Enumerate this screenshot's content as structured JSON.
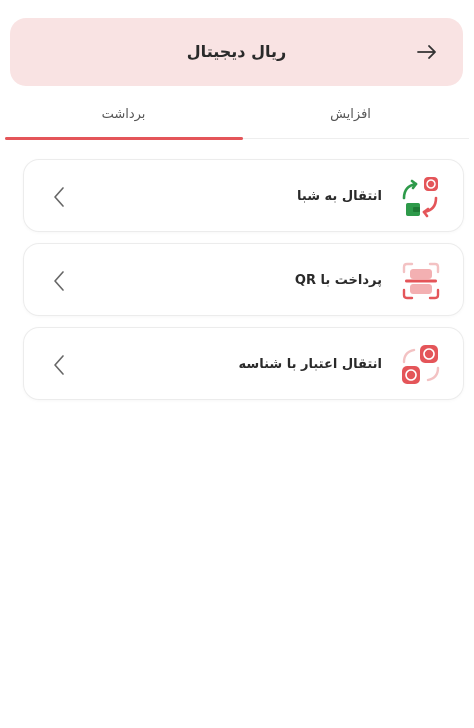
{
  "header": {
    "title": "ریال دیجیتال",
    "back_icon": "arrow-right-icon"
  },
  "tabs": [
    {
      "label": "افزایش",
      "active": false
    },
    {
      "label": "برداشت",
      "active": true
    }
  ],
  "options": [
    {
      "label": "انتقال به شبا",
      "icon": "sheba-transfer-icon",
      "chevron": "chevron-left-icon"
    },
    {
      "label": "پرداخت با QR",
      "icon": "qr-scan-icon",
      "chevron": "chevron-left-icon"
    },
    {
      "label": "انتقال اعتبار با شناسه",
      "icon": "credit-transfer-icon",
      "chevron": "chevron-left-icon"
    }
  ],
  "colors": {
    "accent": "#e45559",
    "header_bg": "#f9e3e3",
    "icon_green": "#2e9a4a"
  }
}
